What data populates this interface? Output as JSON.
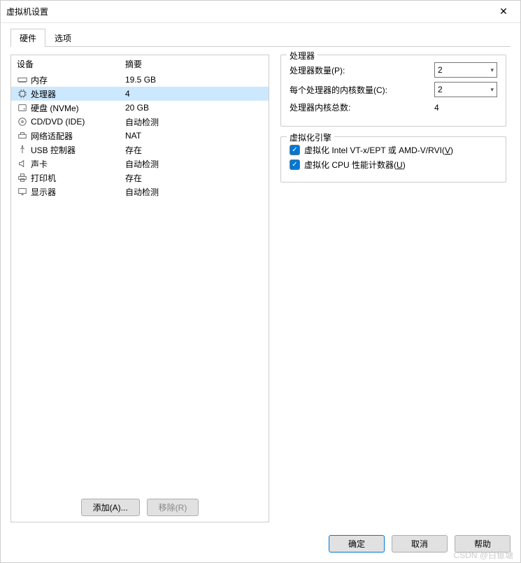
{
  "title": "虚拟机设置",
  "tabs": {
    "hardware": "硬件",
    "options": "选项"
  },
  "columns": {
    "device": "设备",
    "summary": "摘要"
  },
  "devices": [
    {
      "icon": "memory",
      "name": "内存",
      "summary": "19.5 GB",
      "selected": false
    },
    {
      "icon": "cpu",
      "name": "处理器",
      "summary": "4",
      "selected": true
    },
    {
      "icon": "disk",
      "name": "硬盘 (NVMe)",
      "summary": "20 GB",
      "selected": false
    },
    {
      "icon": "cd",
      "name": "CD/DVD (IDE)",
      "summary": "自动检测",
      "selected": false
    },
    {
      "icon": "net",
      "name": "网络适配器",
      "summary": "NAT",
      "selected": false
    },
    {
      "icon": "usb",
      "name": "USB 控制器",
      "summary": "存在",
      "selected": false
    },
    {
      "icon": "sound",
      "name": "声卡",
      "summary": "自动检测",
      "selected": false
    },
    {
      "icon": "printer",
      "name": "打印机",
      "summary": "存在",
      "selected": false
    },
    {
      "icon": "display",
      "name": "显示器",
      "summary": "自动检测",
      "selected": false
    }
  ],
  "left_buttons": {
    "add": "添加(A)...",
    "remove": "移除(R)"
  },
  "processor_group": {
    "legend": "处理器",
    "num_processors_label": "处理器数量(P):",
    "num_processors_value": "2",
    "cores_per_label": "每个处理器的内核数量(C):",
    "cores_per_value": "2",
    "total_label": "处理器内核总数:",
    "total_value": "4"
  },
  "virt_group": {
    "legend": "虚拟化引擎",
    "vt_label_pre": "虚拟化 Intel VT-x/EPT 或 AMD-V/RVI(",
    "vt_hotkey": "V",
    "vt_label_post": ")",
    "counters_label_pre": "虚拟化 CPU 性能计数器(",
    "counters_hotkey": "U",
    "counters_label_post": ")"
  },
  "footer": {
    "ok": "确定",
    "cancel": "取消",
    "help": "帮助"
  },
  "watermark": "CSDN @白鱼塘"
}
